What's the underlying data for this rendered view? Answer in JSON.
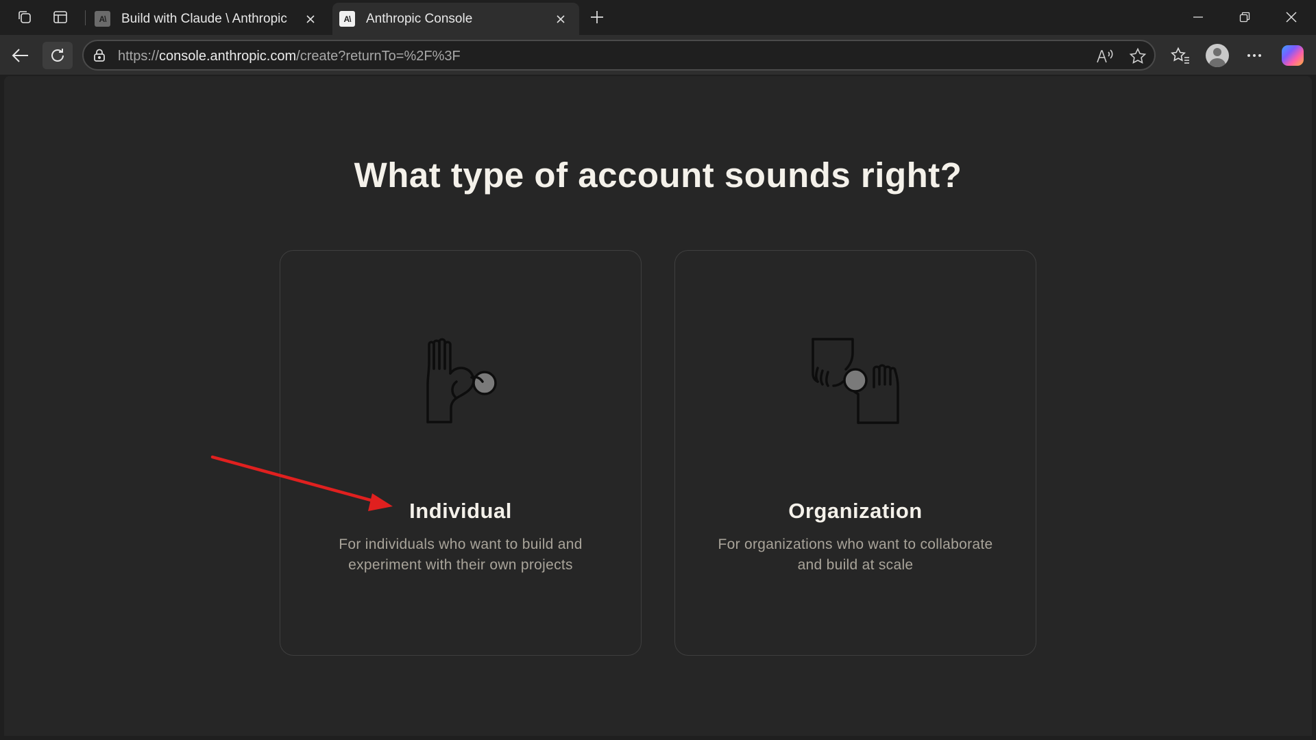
{
  "browser": {
    "tabs": [
      {
        "favicon": "A\\",
        "title": "Build with Claude \\ Anthropic",
        "active": false
      },
      {
        "favicon": "A\\",
        "title": "Anthropic Console",
        "active": true
      }
    ],
    "url": {
      "scheme": "https://",
      "host": "console.anthropic.com",
      "path": "/create?returnTo=%2F%3F"
    },
    "icons": {
      "workspaces": "workspaces-icon",
      "tab_actions": "tab-actions-icon",
      "new_tab": "plus-icon",
      "minimize": "minimize-icon",
      "restore": "restore-icon",
      "close": "close-icon",
      "back": "back-arrow-icon",
      "reload": "reload-icon",
      "lock": "lock-icon",
      "read_aloud": "read-aloud-icon",
      "favorite": "star-icon",
      "favorites": "favorites-icon",
      "profile": "profile-avatar",
      "more": "more-icon",
      "copilot": "copilot-icon"
    }
  },
  "page": {
    "heading": "What type of account sounds right?",
    "cards": [
      {
        "title": "Individual",
        "description": "For individuals who want to build and experiment with their own projects",
        "illustration": "single-hand-holding-coin"
      },
      {
        "title": "Organization",
        "description": "For organizations who want to collaborate and build at scale",
        "illustration": "two-hands-exchanging-coin"
      }
    ]
  },
  "annotation": {
    "arrow_color": "#e0201f",
    "points_to": "Individual"
  },
  "colors": {
    "page_bg": "#262626",
    "chrome_bg": "#1f1f1f",
    "heading": "#f4f1ea",
    "desc": "#a9a49a",
    "card_border": "#3f3f3f",
    "coin": "#7a7a7a"
  }
}
